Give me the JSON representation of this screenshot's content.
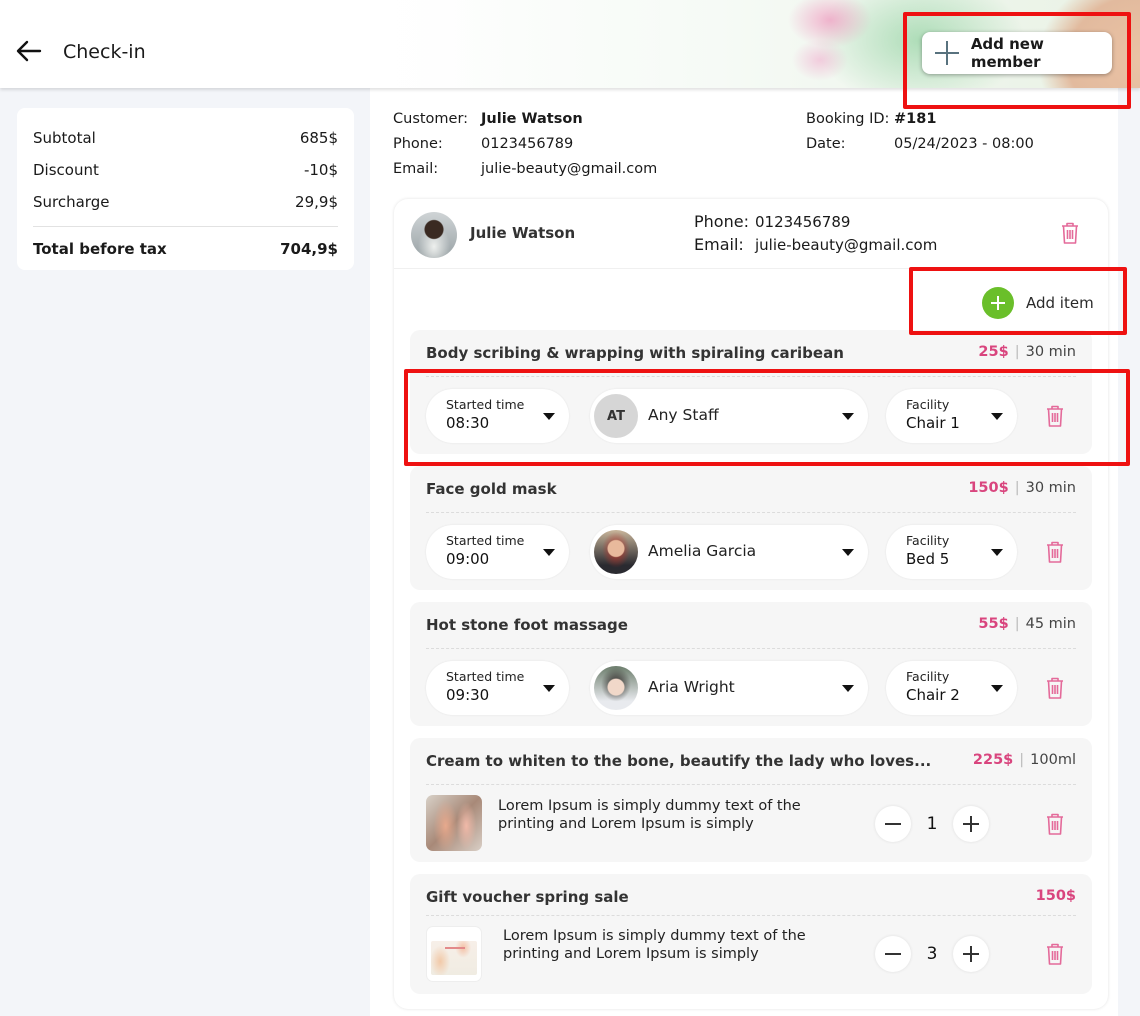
{
  "header": {
    "title": "Check-in",
    "back_icon": "arrow-left-icon",
    "add_member_label": "Add new member",
    "add_member_icon": "plus-icon"
  },
  "summary": {
    "rows": [
      {
        "label": "Subtotal",
        "value": "685$"
      },
      {
        "label": "Discount",
        "value": "-10$"
      },
      {
        "label": "Surcharge",
        "value": "29,9$"
      }
    ],
    "total": {
      "label": "Total before tax",
      "value": "704,9$"
    }
  },
  "booking": {
    "customer_label": "Customer:",
    "customer_name": "Julie Watson",
    "phone_label": "Phone:",
    "phone": "0123456789",
    "email_label": "Email:",
    "email": "julie-beauty@gmail.com",
    "booking_id_label": "Booking ID:",
    "booking_id": "#181",
    "date_label": "Date:",
    "date": "05/24/2023 - 08:00"
  },
  "member": {
    "name": "Julie Watson",
    "phone_label": "Phone:",
    "phone": "0123456789",
    "email_label": "Email:",
    "email": "julie-beauty@gmail.com",
    "add_item_label": "Add item",
    "trash_icon": "trash-icon"
  },
  "colors": {
    "price": "#d9457e",
    "add_item_green": "#6abf2a",
    "trash_pink": "#e46a9a",
    "highlight_red": "#ee1111",
    "panel_bg": "#f3f5f9"
  },
  "services": [
    {
      "title": "Body scribing & wrapping with spiraling caribean",
      "price": "25$",
      "duration": "30 min",
      "time_label": "Started time",
      "time": "08:30",
      "staff_initials": "AT",
      "staff": "Any Staff",
      "facility_label": "Facility",
      "facility": "Chair 1"
    },
    {
      "title": "Face gold mask",
      "price": "150$",
      "duration": "30 min",
      "time_label": "Started time",
      "time": "09:00",
      "staff": "Amelia Garcia",
      "facility_label": "Facility",
      "facility": "Bed 5"
    },
    {
      "title": "Hot stone foot massage",
      "price": "55$",
      "duration": "45 min",
      "time_label": "Started time",
      "time": "09:30",
      "staff": "Aria Wright",
      "facility_label": "Facility",
      "facility": "Chair 2"
    }
  ],
  "products": [
    {
      "title": "Cream to whiten to the bone, beautify the lady who loves...",
      "price": "225$",
      "unit": "100ml",
      "description": "Lorem Ipsum is simply dummy text of the printing and Lorem Ipsum is simply",
      "quantity": "1"
    },
    {
      "title": "Gift voucher spring sale",
      "price": "150$",
      "description": "Lorem Ipsum is simply dummy text of the printing and Lorem Ipsum is simply",
      "quantity": "3"
    }
  ]
}
